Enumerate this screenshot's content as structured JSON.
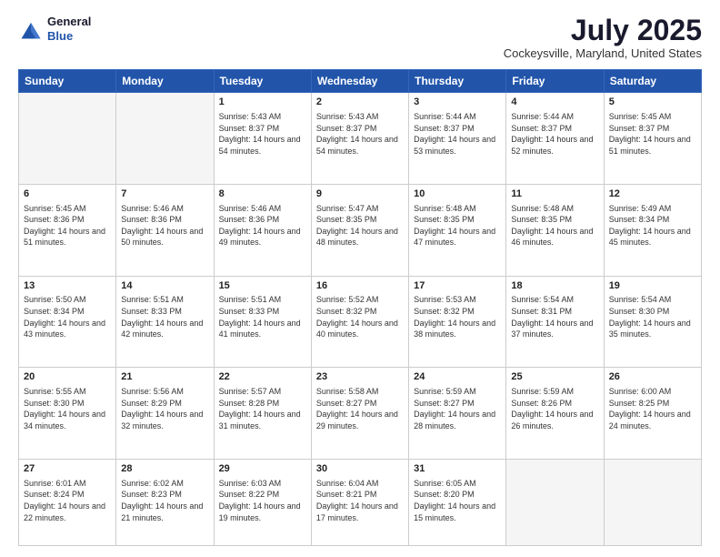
{
  "header": {
    "logo_line1": "General",
    "logo_line2": "Blue",
    "month_year": "July 2025",
    "location": "Cockeysville, Maryland, United States"
  },
  "weekdays": [
    "Sunday",
    "Monday",
    "Tuesday",
    "Wednesday",
    "Thursday",
    "Friday",
    "Saturday"
  ],
  "weeks": [
    [
      {
        "day": "",
        "info": ""
      },
      {
        "day": "",
        "info": ""
      },
      {
        "day": "1",
        "info": "Sunrise: 5:43 AM\nSunset: 8:37 PM\nDaylight: 14 hours and 54 minutes."
      },
      {
        "day": "2",
        "info": "Sunrise: 5:43 AM\nSunset: 8:37 PM\nDaylight: 14 hours and 54 minutes."
      },
      {
        "day": "3",
        "info": "Sunrise: 5:44 AM\nSunset: 8:37 PM\nDaylight: 14 hours and 53 minutes."
      },
      {
        "day": "4",
        "info": "Sunrise: 5:44 AM\nSunset: 8:37 PM\nDaylight: 14 hours and 52 minutes."
      },
      {
        "day": "5",
        "info": "Sunrise: 5:45 AM\nSunset: 8:37 PM\nDaylight: 14 hours and 51 minutes."
      }
    ],
    [
      {
        "day": "6",
        "info": "Sunrise: 5:45 AM\nSunset: 8:36 PM\nDaylight: 14 hours and 51 minutes."
      },
      {
        "day": "7",
        "info": "Sunrise: 5:46 AM\nSunset: 8:36 PM\nDaylight: 14 hours and 50 minutes."
      },
      {
        "day": "8",
        "info": "Sunrise: 5:46 AM\nSunset: 8:36 PM\nDaylight: 14 hours and 49 minutes."
      },
      {
        "day": "9",
        "info": "Sunrise: 5:47 AM\nSunset: 8:35 PM\nDaylight: 14 hours and 48 minutes."
      },
      {
        "day": "10",
        "info": "Sunrise: 5:48 AM\nSunset: 8:35 PM\nDaylight: 14 hours and 47 minutes."
      },
      {
        "day": "11",
        "info": "Sunrise: 5:48 AM\nSunset: 8:35 PM\nDaylight: 14 hours and 46 minutes."
      },
      {
        "day": "12",
        "info": "Sunrise: 5:49 AM\nSunset: 8:34 PM\nDaylight: 14 hours and 45 minutes."
      }
    ],
    [
      {
        "day": "13",
        "info": "Sunrise: 5:50 AM\nSunset: 8:34 PM\nDaylight: 14 hours and 43 minutes."
      },
      {
        "day": "14",
        "info": "Sunrise: 5:51 AM\nSunset: 8:33 PM\nDaylight: 14 hours and 42 minutes."
      },
      {
        "day": "15",
        "info": "Sunrise: 5:51 AM\nSunset: 8:33 PM\nDaylight: 14 hours and 41 minutes."
      },
      {
        "day": "16",
        "info": "Sunrise: 5:52 AM\nSunset: 8:32 PM\nDaylight: 14 hours and 40 minutes."
      },
      {
        "day": "17",
        "info": "Sunrise: 5:53 AM\nSunset: 8:32 PM\nDaylight: 14 hours and 38 minutes."
      },
      {
        "day": "18",
        "info": "Sunrise: 5:54 AM\nSunset: 8:31 PM\nDaylight: 14 hours and 37 minutes."
      },
      {
        "day": "19",
        "info": "Sunrise: 5:54 AM\nSunset: 8:30 PM\nDaylight: 14 hours and 35 minutes."
      }
    ],
    [
      {
        "day": "20",
        "info": "Sunrise: 5:55 AM\nSunset: 8:30 PM\nDaylight: 14 hours and 34 minutes."
      },
      {
        "day": "21",
        "info": "Sunrise: 5:56 AM\nSunset: 8:29 PM\nDaylight: 14 hours and 32 minutes."
      },
      {
        "day": "22",
        "info": "Sunrise: 5:57 AM\nSunset: 8:28 PM\nDaylight: 14 hours and 31 minutes."
      },
      {
        "day": "23",
        "info": "Sunrise: 5:58 AM\nSunset: 8:27 PM\nDaylight: 14 hours and 29 minutes."
      },
      {
        "day": "24",
        "info": "Sunrise: 5:59 AM\nSunset: 8:27 PM\nDaylight: 14 hours and 28 minutes."
      },
      {
        "day": "25",
        "info": "Sunrise: 5:59 AM\nSunset: 8:26 PM\nDaylight: 14 hours and 26 minutes."
      },
      {
        "day": "26",
        "info": "Sunrise: 6:00 AM\nSunset: 8:25 PM\nDaylight: 14 hours and 24 minutes."
      }
    ],
    [
      {
        "day": "27",
        "info": "Sunrise: 6:01 AM\nSunset: 8:24 PM\nDaylight: 14 hours and 22 minutes."
      },
      {
        "day": "28",
        "info": "Sunrise: 6:02 AM\nSunset: 8:23 PM\nDaylight: 14 hours and 21 minutes."
      },
      {
        "day": "29",
        "info": "Sunrise: 6:03 AM\nSunset: 8:22 PM\nDaylight: 14 hours and 19 minutes."
      },
      {
        "day": "30",
        "info": "Sunrise: 6:04 AM\nSunset: 8:21 PM\nDaylight: 14 hours and 17 minutes."
      },
      {
        "day": "31",
        "info": "Sunrise: 6:05 AM\nSunset: 8:20 PM\nDaylight: 14 hours and 15 minutes."
      },
      {
        "day": "",
        "info": ""
      },
      {
        "day": "",
        "info": ""
      }
    ]
  ]
}
